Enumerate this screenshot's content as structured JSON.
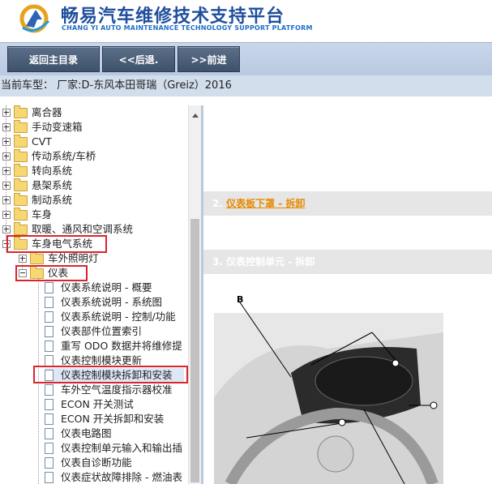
{
  "header": {
    "brand_cn": "畅易汽车维修技术支持平台",
    "brand_en": "CHANG YI AUTO MAINTENANCE TECHNOLOGY SUPPORT PLATFORM"
  },
  "nav": {
    "home": "返回主目录",
    "back": "<<后退.",
    "forward": ">>前进"
  },
  "car_bar": "当前车型：  厂家:D-东风本田哥瑞（Greiz）2016",
  "tree": {
    "items": [
      {
        "label": "离合器"
      },
      {
        "label": "手动变速箱"
      },
      {
        "label": "CVT"
      },
      {
        "label": "传动系统/车桥"
      },
      {
        "label": "转向系统"
      },
      {
        "label": "悬架系统"
      },
      {
        "label": "制动系统"
      },
      {
        "label": "车身"
      },
      {
        "label": "取暖、通风和空调系统"
      },
      {
        "label": "车身电气系统"
      },
      {
        "label": "车外照明灯"
      },
      {
        "label": "仪表"
      },
      {
        "label": "仪表系统说明 - 概要"
      },
      {
        "label": "仪表系统说明 - 系统图"
      },
      {
        "label": "仪表系统说明 - 控制/功能"
      },
      {
        "label": "仪表部件位置索引"
      },
      {
        "label": "重写 ODO 数据并将维修提"
      },
      {
        "label": "仪表控制模块更新"
      },
      {
        "label": "仪表控制模块拆卸和安装"
      },
      {
        "label": "车外空气温度指示器校准"
      },
      {
        "label": "ECON 开关测试"
      },
      {
        "label": "ECON 开关拆卸和安装"
      },
      {
        "label": "仪表电路图"
      },
      {
        "label": "仪表控制单元输入和输出插"
      },
      {
        "label": "仪表自诊断功能"
      },
      {
        "label": "仪表症状故障排除 - 燃油表"
      }
    ]
  },
  "content": {
    "section2_num": "2.",
    "section2_link": "仪表板下罩 - 拆卸",
    "section3": "3. 仪表控制单元 - 拆卸",
    "figure_label_b": "B"
  }
}
